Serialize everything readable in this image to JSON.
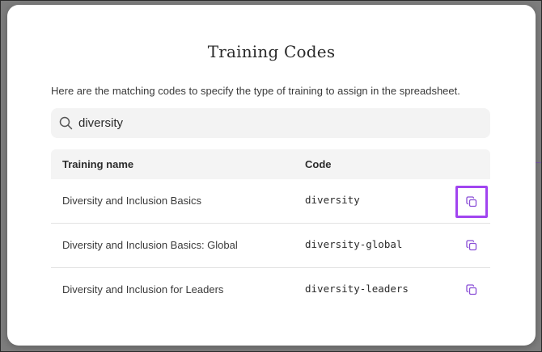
{
  "modal": {
    "title": "Training Codes",
    "description": "Here are the matching codes to specify the type of training to assign in the spreadsheet."
  },
  "search": {
    "value": "diversity",
    "icon": "search-icon"
  },
  "table": {
    "headers": {
      "name": "Training name",
      "code": "Code"
    },
    "rows": [
      {
        "name": "Diversity and Inclusion Basics",
        "code": "diversity",
        "highlighted": true
      },
      {
        "name": "Diversity and Inclusion Basics: Global",
        "code": "diversity-global",
        "highlighted": false
      },
      {
        "name": "Diversity and Inclusion for Leaders",
        "code": "diversity-leaders",
        "highlighted": false
      }
    ]
  },
  "colors": {
    "accent": "#8a4fd6",
    "highlight": "#a144f0"
  }
}
